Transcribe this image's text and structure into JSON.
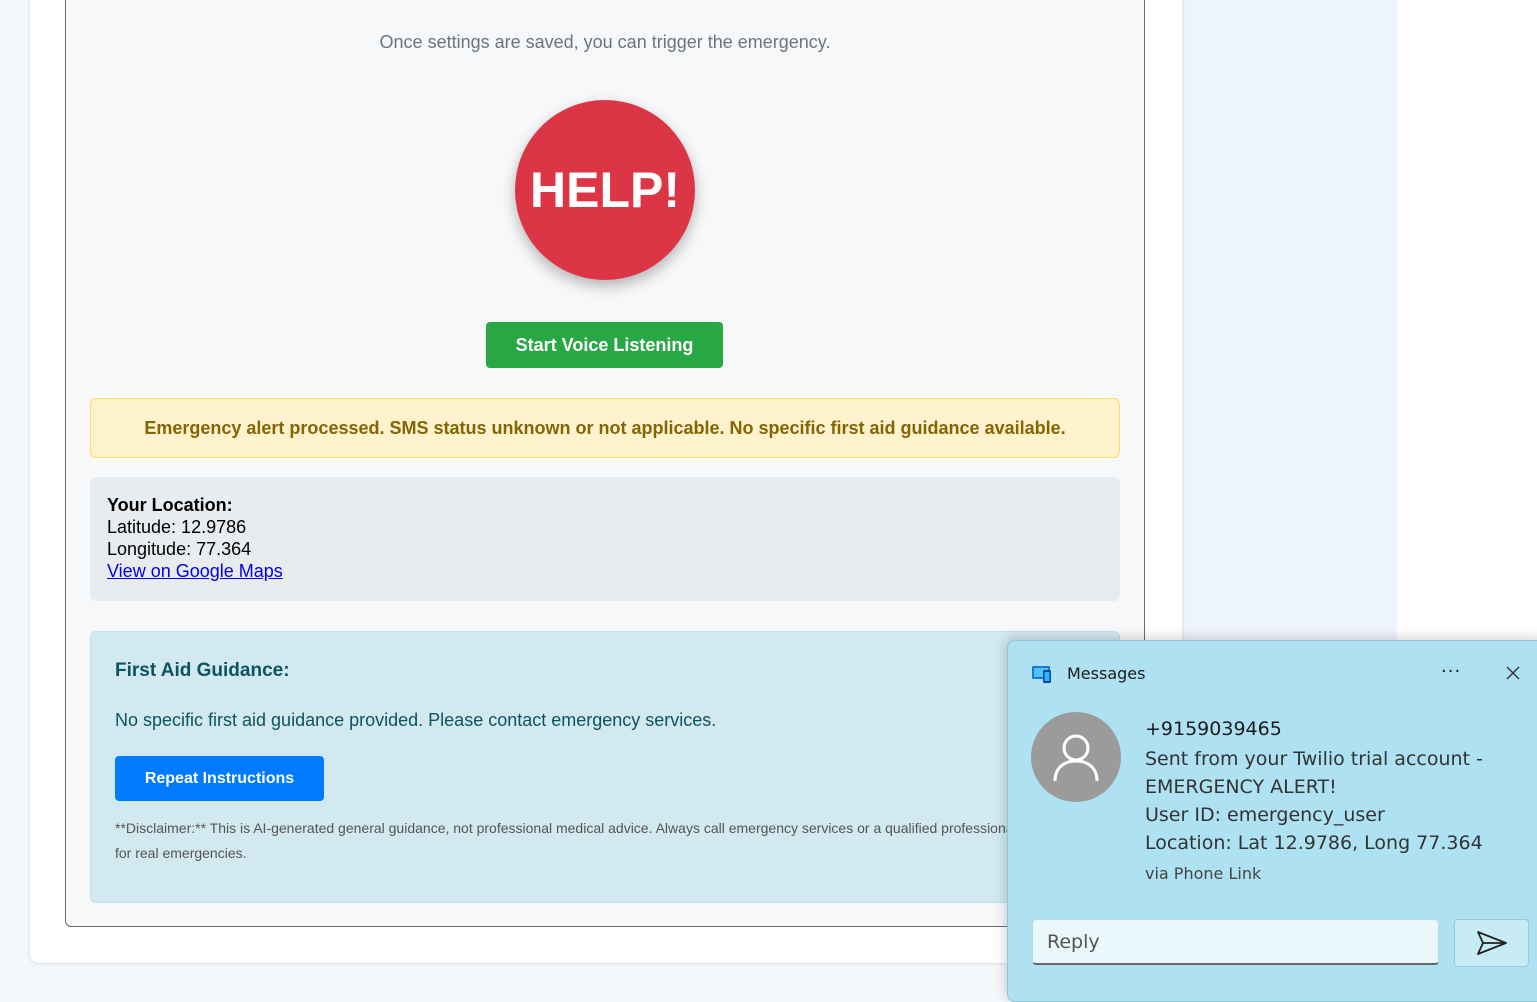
{
  "main": {
    "instruction": "Once settings are saved, you can trigger the emergency.",
    "help_label": "HELP!",
    "voice_label": "Start Voice Listening",
    "alert": "Emergency alert processed. SMS status unknown or not applicable. No specific first aid guidance available.",
    "location": {
      "title": "Your Location:",
      "latitude": "Latitude: 12.9786",
      "longitude": "Longitude: 77.364",
      "map_link": "View on Google Maps"
    },
    "first_aid": {
      "title": "First Aid Guidance:",
      "text": "No specific first aid guidance provided. Please contact emergency services.",
      "repeat_label": "Repeat Instructions",
      "disclaimer": "**Disclaimer:** This is AI-generated general guidance, not professional medical advice. Always call emergency services or a qualified professional for real emergencies."
    }
  },
  "notification": {
    "app_name": "Messages",
    "more_label": "···",
    "sender": "+9159039465",
    "body_lines": [
      "Sent from your Twilio trial account -",
      "EMERGENCY ALERT!",
      "User ID: emergency_user",
      "Location: Lat 12.9786, Long 77.364"
    ],
    "via": "via Phone Link",
    "reply_placeholder": "Reply",
    "icons": {
      "app": "phone-link-icon",
      "close": "close-icon",
      "avatar": "person-icon",
      "send": "send-icon"
    }
  },
  "colors": {
    "help": "#dc3545",
    "voice": "#28a745",
    "repeat": "#007bff",
    "alert_bg": "#fff3cd",
    "alert_text": "#856404",
    "aid_bg": "#d1e9ef",
    "toast_bg": "#aee2f3"
  }
}
